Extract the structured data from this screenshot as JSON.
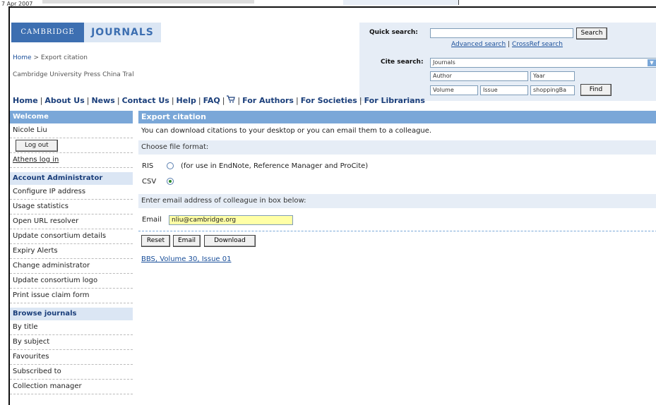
{
  "background": {
    "date": "7 Apr 2007"
  },
  "logo": {
    "cambridge": "CAMBRIDGE",
    "journals": "JOURNALS"
  },
  "breadcrumb": {
    "home": "Home",
    "separator": " > ",
    "current": "Export citation"
  },
  "institution": "Cambridge University Press China Tral",
  "search": {
    "quick_label": "Quick search:",
    "quick_value": "",
    "search_button": "Search",
    "advanced_link": "Advanced search",
    "link_sep": " | ",
    "crossref_link": "CrossRef search",
    "cite_label": "Cite search:",
    "cite_select": "Journals",
    "author": "Author",
    "year": "Yaar",
    "volume": "Volume",
    "issue": "Issue",
    "shopping": "shoppingBa",
    "find_button": "Find"
  },
  "nav": [
    "Home",
    "About Us",
    "News",
    "Contact Us",
    "Help",
    "FAQ",
    "For Authors",
    "For Societies",
    "For Librarians"
  ],
  "sidebar": {
    "welcome_head": "Welcome",
    "user": "Nicole Liu",
    "logout": "Log out",
    "athens": "Athens log in",
    "admin_head": "Account Administrator",
    "admin_items": [
      "Configure IP address",
      "Usage statistics",
      "Open URL resolver",
      "Update consortium details",
      "Expiry Alerts",
      "Change administrator",
      "Update consortium logo",
      "Print issue claim form"
    ],
    "browse_head": "Browse journals",
    "browse_items": [
      "By title",
      "By subject",
      "Favourites",
      "Subscribed to",
      "Collection manager"
    ]
  },
  "content": {
    "title": "Export citation",
    "intro": "You can download citations to your desktop or you can email them to a colleague.",
    "choose_format": "Choose file format:",
    "ris_label": "RIS",
    "ris_desc": "(for use in EndNote, Reference Manager and ProCite)",
    "csv_label": "CSV",
    "selected_format": "CSV",
    "email_prompt": "Enter email address of colleague in box below:",
    "email_label": "Email",
    "email_value": "nliu@cambridge.org",
    "reset_button": "Reset",
    "email_button": "Email",
    "download_button": "Download",
    "citation_link": "BBS, Volume 30, Issue 01"
  }
}
